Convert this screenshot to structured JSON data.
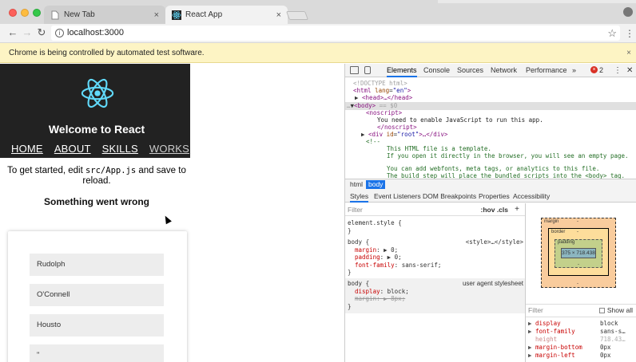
{
  "browser": {
    "tabs": [
      {
        "title": "New Tab",
        "close": "×"
      },
      {
        "title": "React App",
        "close": "×"
      }
    ],
    "url": "localhost:3000",
    "infobar": {
      "message": "Chrome is being controlled by automated test software.",
      "close": "×"
    }
  },
  "page": {
    "welcome": "Welcome to React",
    "nav": [
      "HOME",
      "ABOUT",
      "SKILLS",
      "WORKS"
    ],
    "intro_before": "To get started, edit ",
    "intro_code": "src/App.js",
    "intro_after": " and save to reload.",
    "error": "Something went wrong",
    "fields": [
      "Rudolph",
      "O'Connell",
      "Housto",
      "\""
    ]
  },
  "devtools": {
    "tabs": [
      "Elements",
      "Console",
      "Sources",
      "Network",
      "Performance"
    ],
    "more": "»",
    "error_count": "2",
    "breadcrumbs": [
      "html",
      "body"
    ],
    "sub_tabs": [
      "Styles",
      "Event Listeners",
      "DOM Breakpoints",
      "Properties",
      "Accessibility"
    ],
    "dom": {
      "doctype": "<!DOCTYPE html>",
      "html_open_tag": "html",
      "html_attr": "lang",
      "html_val": "\"en\"",
      "head": "<head>…</head>",
      "body": "<body>",
      "body_sel": " == $0",
      "noscript_open": "<noscript>",
      "noscript_text": "You need to enable JavaScript to run this app.",
      "noscript_close": "</noscript>",
      "div_tag": "div",
      "div_attr": "id",
      "div_val": "\"root\"",
      "div_rest": ">…</div>",
      "comment_open": "<!--",
      "comment_1": "This HTML file is a template.",
      "comment_2": "If you open it directly in the browser, you will see an empty page.",
      "comment_3": "You can add webfonts, meta tags, or analytics to this file.",
      "comment_4": "The build step will place the bundled scripts into the <body> tag."
    },
    "styles": {
      "filter_placeholder": "Filter",
      "filter_opts": ":hov  .cls",
      "plus": "+",
      "element_style": "element.style {",
      "close_brace": "}",
      "rule1_selector": "body {",
      "rule1_src": "<style>…</style>",
      "rule1_props": [
        {
          "name": "margin",
          "value": "0;"
        },
        {
          "name": "padding",
          "value": "0;"
        },
        {
          "name": "font-family",
          "value": "sans-serif;"
        }
      ],
      "rule2_selector": "body {",
      "rule2_src": "user agent stylesheet",
      "rule2_props": [
        {
          "name": "display",
          "value": "block;"
        },
        {
          "name": "margin",
          "value": "8px;"
        }
      ]
    },
    "boxmodel": {
      "margin_label": "margin",
      "border_label": "border",
      "padding_label": "padding",
      "dash": "-",
      "content": "375 × 718.438"
    },
    "computed": {
      "filter_placeholder": "Filter",
      "show_all": "Show all",
      "props": [
        {
          "name": "display",
          "value": "block"
        },
        {
          "name": "font-family",
          "value": "sans-s…"
        },
        {
          "name": "height",
          "value": "718.43…"
        },
        {
          "name": "margin-bottom",
          "value": "0px"
        },
        {
          "name": "margin-left",
          "value": "0px"
        }
      ]
    }
  },
  "colors": {
    "react": "#61dafb",
    "header_bg": "#222222",
    "infobar": "#fdf4c4",
    "devtools_accent": "#1a73e8"
  }
}
